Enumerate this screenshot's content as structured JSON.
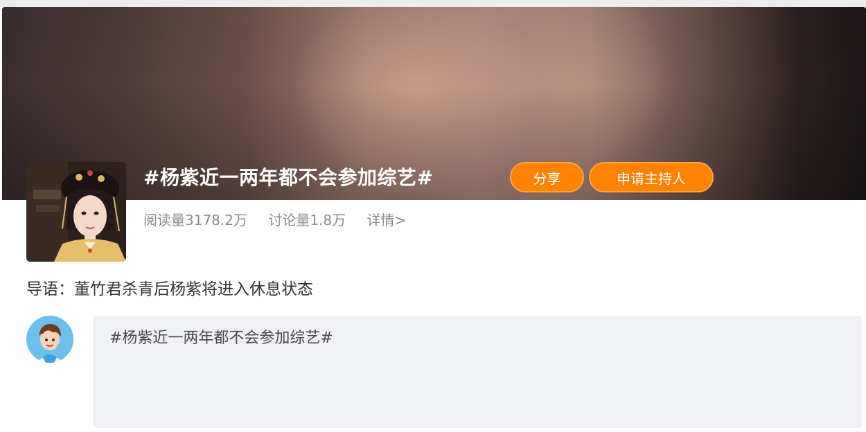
{
  "topic": {
    "title": "#杨紫近一两年都不会参加综艺#",
    "share_label": "分享",
    "apply_host_label": "申请主持人"
  },
  "stats": {
    "reads": "阅读量3178.2万",
    "discussions": "讨论量1.8万",
    "detail_link": "详情>"
  },
  "intro": {
    "text": "导语：董竹君杀青后杨紫将进入休息状态"
  },
  "composer": {
    "text": "#杨紫近一两年都不会参加综艺#"
  },
  "colors": {
    "accent": "#ff8200",
    "stats_text": "#8a8a8a",
    "composer_bg": "#f0f1f4"
  },
  "icons": {
    "cover": "topic-cover-image",
    "avatar": "user-avatar-image"
  }
}
